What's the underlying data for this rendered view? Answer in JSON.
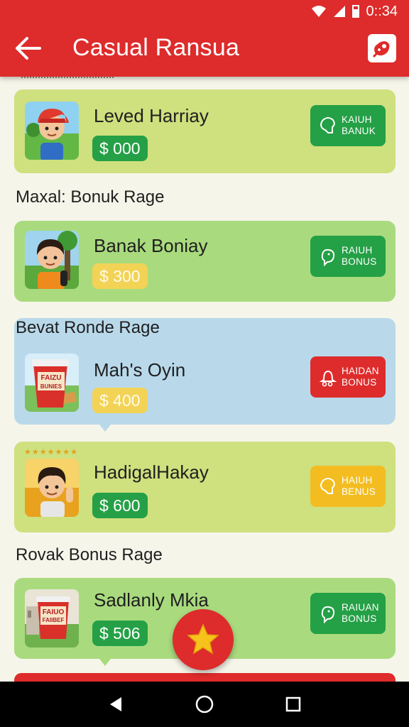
{
  "status_bar": {
    "time": "0::34",
    "icons": [
      "wifi-icon",
      "signal-icon",
      "battery-icon"
    ]
  },
  "app_bar": {
    "title": "Casual Ransua",
    "back_icon": "arrow-left-icon",
    "action_icon": "gift-icon"
  },
  "colors": {
    "primary_red": "#de2b2b",
    "green": "#25a046",
    "yellow": "#f3bd22",
    "card_lime": "#cfe07e",
    "card_green": "#a9db7e",
    "card_blue": "#b9d9eb"
  },
  "cards": [
    {
      "name": "Leved Harriay",
      "amount": "$ 000",
      "button": [
        "KAIUH",
        "BANUK"
      ],
      "button_color": "green"
    },
    {
      "section": "Maxal: Bonuk Rage",
      "name": "Banak Boniay",
      "amount": "$ 300",
      "button": [
        "RAIUH",
        "BONUS"
      ],
      "button_color": "green"
    },
    {
      "section": "Bevat Ronde Rage",
      "name": "Mah's Oyin",
      "amount": "$ 400",
      "button": [
        "HAIDAN",
        "BONUS"
      ],
      "button_color": "red",
      "thumb_text": [
        "FAIZU",
        "BUNIES"
      ]
    },
    {
      "name": "HadigalHakay",
      "amount": "$ 600",
      "button": [
        "HAIUH",
        "BENUS"
      ],
      "button_color": "yellow"
    },
    {
      "section": "Rovak Bonus Rage",
      "name": "Sadlanly Mkia",
      "amount": "$ 506",
      "button": [
        "RAIUAN",
        "BONUS"
      ],
      "button_color": "green",
      "thumb_text": [
        "FAIUO",
        "FAIIBEF"
      ]
    }
  ],
  "fab": {
    "icon": "star-icon"
  },
  "nav": {
    "icons": [
      "back-triangle-icon",
      "home-circle-icon",
      "recents-square-icon"
    ]
  }
}
